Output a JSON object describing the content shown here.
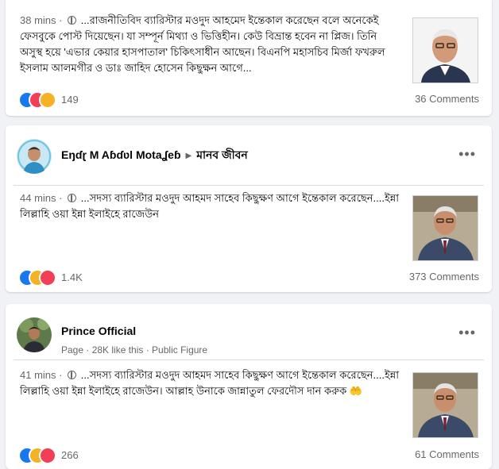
{
  "posts": [
    {
      "time": "38 mins",
      "text": "...রাজনীতিবিদ ব্যারিস্টার মওদুদ আহমেদ ইন্তেকাল করেছেন বলে অনেকেই ফেসবুকে পোস্ট দিয়েছেন। যা সম্পূর্ন মিথ্যা ও ভিত্তিহীন। কেউ বিভ্রান্ত হবেন না প্লিজ। তিনি অসুস্থ হয়ে 'এভার কেয়ার হাসপাতাল' চিকিৎসাধীন আছেন। বিএনপি মহাসচিব মির্জা ফখরুল ইসলাম আলমগীর ও ডাঃ জাহিদ হোসেন কিছুক্ষন আগে...",
      "reactions": [
        "like",
        "love",
        "sad"
      ],
      "reaction_count": "149",
      "comments": "36 Comments"
    },
    {
      "author": "Eŋɗɽ M Aɓɗʋl Motaʆeɓ",
      "group": "মানব জীবন",
      "time": "44 mins",
      "text": "...সদস্য ব্যারিস্টার মওদুদ আহমদ সাহেব কিছুক্ষণ আগে ইন্তেকাল করেছেন....ইন্না লিল্লাহি ওয়া ইন্না ইলাইহে রাজেউন",
      "reactions": [
        "like",
        "sad",
        "love"
      ],
      "reaction_count": "1.4K",
      "comments": "373 Comments"
    },
    {
      "author": "Prince Official",
      "subline": "Page · 28K like this · Public Figure",
      "time": "41 mins",
      "text": "...সদস্য ব্যারিস্টার মওদুদ আহমদ সাহেব কিছুক্ষণ আগে ইন্তেকাল করেছেন....ইন্না লিল্লাহি ওয়া ইন্না ইলাইহে রাজেউন। আল্লাহ উনাকে জান্নাতুল ফেরদৌস দান করুক",
      "emoji": "🤲",
      "reactions": [
        "like",
        "sad",
        "love"
      ],
      "reaction_count": "266",
      "comments": "61 Comments"
    }
  ],
  "menu_glyph": "•••",
  "group_arrow": "▶",
  "colors": {
    "like": "#1877f2",
    "love": "#f33e58",
    "sad": "#f7b125"
  }
}
